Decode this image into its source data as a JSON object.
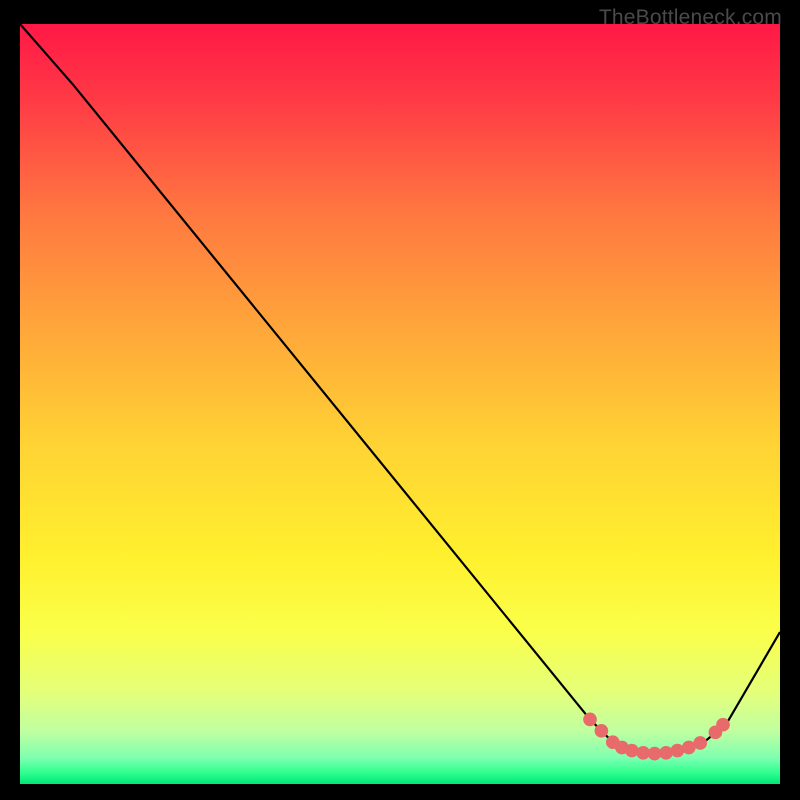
{
  "watermark": "TheBottleneck.com",
  "chart_data": {
    "type": "line",
    "title": "",
    "xlabel": "",
    "ylabel": "",
    "xlim": [
      0,
      100
    ],
    "ylim": [
      0,
      100
    ],
    "grid": false,
    "background": {
      "type": "vertical-gradient",
      "stops": [
        {
          "offset": 0.0,
          "color": "#ff1846"
        },
        {
          "offset": 0.1,
          "color": "#ff3a46"
        },
        {
          "offset": 0.25,
          "color": "#ff7840"
        },
        {
          "offset": 0.4,
          "color": "#ffa63a"
        },
        {
          "offset": 0.55,
          "color": "#ffd234"
        },
        {
          "offset": 0.7,
          "color": "#fff02e"
        },
        {
          "offset": 0.8,
          "color": "#faff4a"
        },
        {
          "offset": 0.88,
          "color": "#e4ff7a"
        },
        {
          "offset": 0.93,
          "color": "#c0ffa0"
        },
        {
          "offset": 0.965,
          "color": "#80ffb0"
        },
        {
          "offset": 0.985,
          "color": "#30ff90"
        },
        {
          "offset": 1.0,
          "color": "#00e878"
        }
      ]
    },
    "series": [
      {
        "name": "bottleneck-curve",
        "stroke": "#000000",
        "stroke_width": 2.2,
        "points": [
          {
            "x": 0.0,
            "y": 100.0
          },
          {
            "x": 7.0,
            "y": 92.0
          },
          {
            "x": 75.0,
            "y": 8.5
          },
          {
            "x": 78.0,
            "y": 5.5
          },
          {
            "x": 81.0,
            "y": 4.3
          },
          {
            "x": 84.0,
            "y": 4.0
          },
          {
            "x": 87.0,
            "y": 4.3
          },
          {
            "x": 90.0,
            "y": 5.5
          },
          {
            "x": 93.0,
            "y": 8.0
          },
          {
            "x": 100.0,
            "y": 20.0
          }
        ]
      }
    ],
    "markers": {
      "name": "valley-dots",
      "color": "#e86a6a",
      "radius_world": 0.9,
      "points": [
        {
          "x": 75.0,
          "y": 8.5
        },
        {
          "x": 76.5,
          "y": 7.0
        },
        {
          "x": 78.0,
          "y": 5.5
        },
        {
          "x": 79.2,
          "y": 4.8
        },
        {
          "x": 80.5,
          "y": 4.4
        },
        {
          "x": 82.0,
          "y": 4.1
        },
        {
          "x": 83.5,
          "y": 4.0
        },
        {
          "x": 85.0,
          "y": 4.1
        },
        {
          "x": 86.5,
          "y": 4.4
        },
        {
          "x": 88.0,
          "y": 4.8
        },
        {
          "x": 89.5,
          "y": 5.4
        },
        {
          "x": 91.5,
          "y": 6.8
        },
        {
          "x": 92.5,
          "y": 7.8
        }
      ]
    }
  }
}
